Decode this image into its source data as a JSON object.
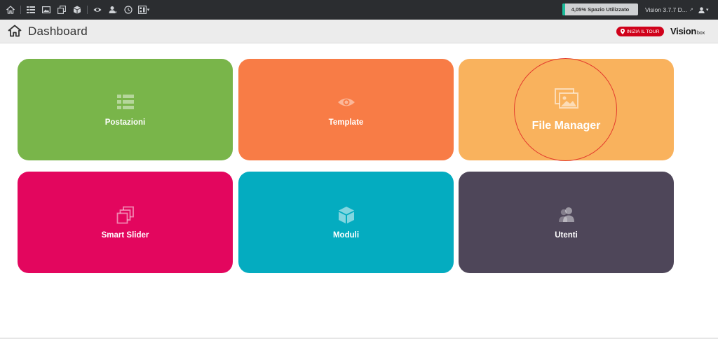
{
  "topbar": {
    "storage_label": "4,05% Spazio Utilizzato",
    "storage_percent": 4.05,
    "version_label": "Vision 3.7.7 D...",
    "icons": [
      "home-icon",
      "list-icon",
      "image-icon",
      "slider-icon",
      "cube-icon",
      "eye-icon",
      "users-icon",
      "clock-icon",
      "layout-icon",
      "user-icon"
    ]
  },
  "header": {
    "title": "Dashboard",
    "tour_button": "INIZIA IL TOUR",
    "logo_main": "Vision",
    "logo_sub": "box"
  },
  "tiles": [
    {
      "label": "Postazioni",
      "icon": "list-icon",
      "color": "#79b54a"
    },
    {
      "label": "Template",
      "icon": "eye-icon",
      "color": "#f87c46"
    },
    {
      "label": "File Manager",
      "icon": "image-icon",
      "color": "#f9b25d"
    },
    {
      "label": "Smart Slider",
      "icon": "slider-icon",
      "color": "#e3065e"
    },
    {
      "label": "Moduli",
      "icon": "cube-icon",
      "color": "#04acc0"
    },
    {
      "label": "Utenti",
      "icon": "users-icon",
      "color": "#4e4659"
    }
  ],
  "colors": {
    "navbar": "#2b2d30",
    "storage_fill": "#1bbc9b",
    "tour_button": "#d0021b",
    "highlight_ring": "#e33b2e"
  }
}
